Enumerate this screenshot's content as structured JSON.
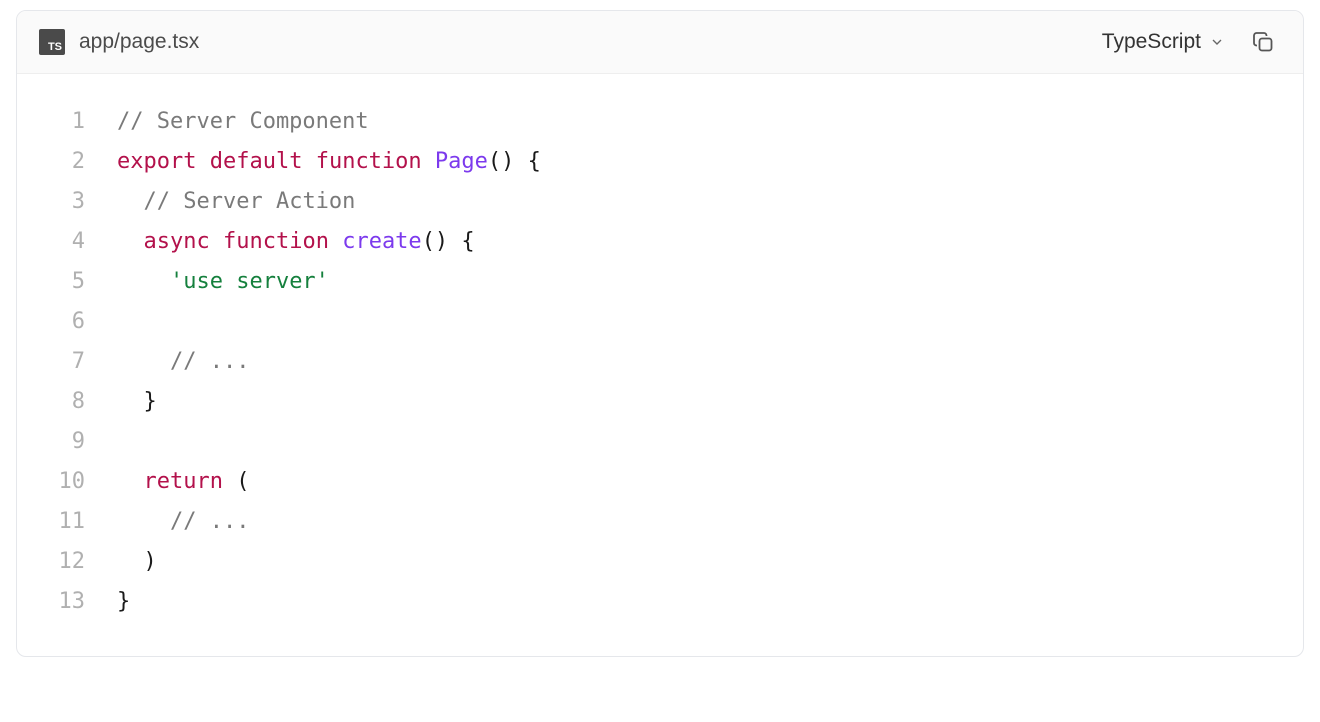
{
  "header": {
    "file_icon_label": "TS",
    "file_name": "app/page.tsx",
    "language_label": "TypeScript"
  },
  "code": {
    "lines": [
      {
        "n": "1",
        "tokens": [
          {
            "t": "// Server Component",
            "c": "comment"
          }
        ]
      },
      {
        "n": "2",
        "tokens": [
          {
            "t": "export",
            "c": "keyword"
          },
          {
            "t": " ",
            "c": "punct"
          },
          {
            "t": "default",
            "c": "keyword"
          },
          {
            "t": " ",
            "c": "punct"
          },
          {
            "t": "function",
            "c": "keyword"
          },
          {
            "t": " ",
            "c": "punct"
          },
          {
            "t": "Page",
            "c": "fn"
          },
          {
            "t": "() {",
            "c": "punct"
          }
        ]
      },
      {
        "n": "3",
        "tokens": [
          {
            "t": "  ",
            "c": "punct"
          },
          {
            "t": "// Server Action",
            "c": "comment"
          }
        ]
      },
      {
        "n": "4",
        "tokens": [
          {
            "t": "  ",
            "c": "punct"
          },
          {
            "t": "async",
            "c": "keyword"
          },
          {
            "t": " ",
            "c": "punct"
          },
          {
            "t": "function",
            "c": "keyword"
          },
          {
            "t": " ",
            "c": "punct"
          },
          {
            "t": "create",
            "c": "fn"
          },
          {
            "t": "() {",
            "c": "punct"
          }
        ]
      },
      {
        "n": "5",
        "tokens": [
          {
            "t": "    ",
            "c": "punct"
          },
          {
            "t": "'use server'",
            "c": "string"
          }
        ]
      },
      {
        "n": "6",
        "tokens": [
          {
            "t": " ",
            "c": "punct"
          }
        ]
      },
      {
        "n": "7",
        "tokens": [
          {
            "t": "    ",
            "c": "punct"
          },
          {
            "t": "// ...",
            "c": "comment"
          }
        ]
      },
      {
        "n": "8",
        "tokens": [
          {
            "t": "  }",
            "c": "punct"
          }
        ]
      },
      {
        "n": "9",
        "tokens": [
          {
            "t": " ",
            "c": "punct"
          }
        ]
      },
      {
        "n": "10",
        "tokens": [
          {
            "t": "  ",
            "c": "punct"
          },
          {
            "t": "return",
            "c": "keyword"
          },
          {
            "t": " (",
            "c": "punct"
          }
        ]
      },
      {
        "n": "11",
        "tokens": [
          {
            "t": "    ",
            "c": "punct"
          },
          {
            "t": "// ...",
            "c": "comment"
          }
        ]
      },
      {
        "n": "12",
        "tokens": [
          {
            "t": "  )",
            "c": "punct"
          }
        ]
      },
      {
        "n": "13",
        "tokens": [
          {
            "t": "}",
            "c": "punct"
          }
        ]
      }
    ]
  }
}
